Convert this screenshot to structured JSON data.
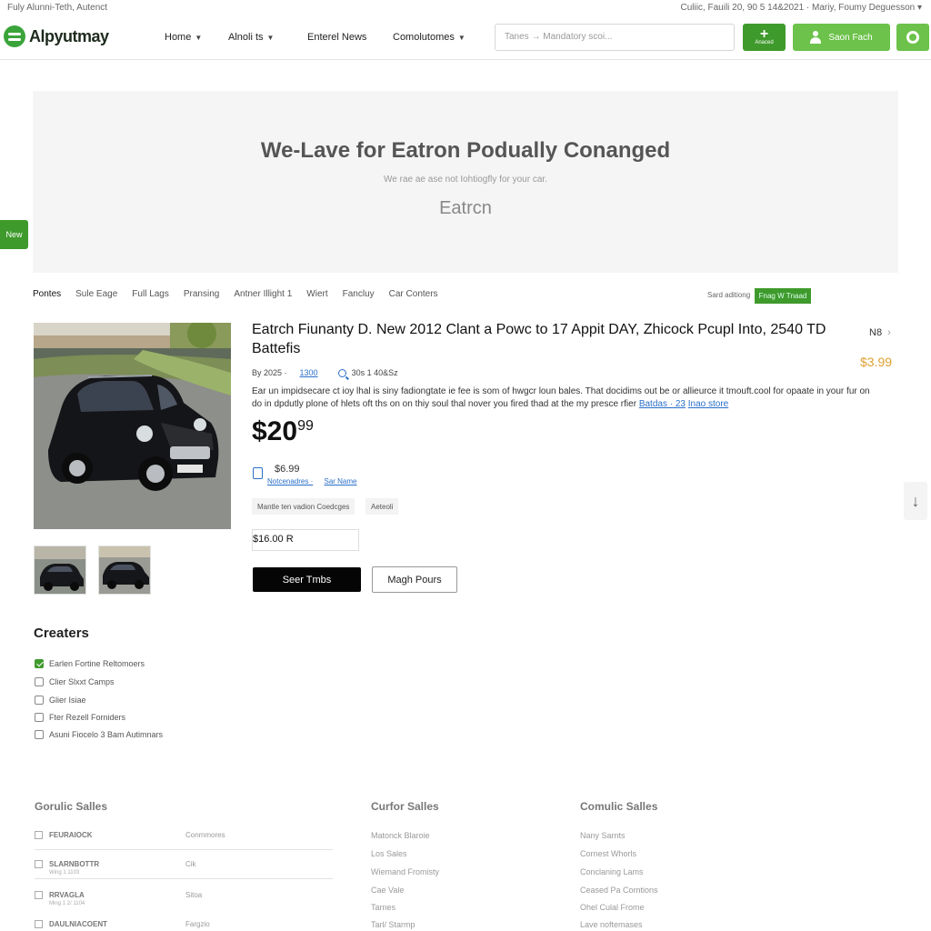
{
  "topbar": {
    "left_text": "Fuly Alunni-Teth, Autenct",
    "right_text": "Culiic, Fauili 20, 90 5 14&2021 · Mariy, Foumy Deguesson ▾"
  },
  "header": {
    "logo_text": "Alpyutmay",
    "nav": [
      {
        "label": "Home",
        "has_caret": true
      },
      {
        "label": "Alnoli ts",
        "has_caret": true
      },
      {
        "label": "Enterel News",
        "has_caret": false
      },
      {
        "label": "Comolutomes",
        "has_caret": true
      }
    ],
    "search_placeholder": "Tanes → Mandatory scoi...",
    "add_button_caption": "Anaced",
    "account_button_label": "Saon Fach",
    "icons": [
      "plus-icon",
      "user-icon",
      "gear-icon"
    ],
    "accent_color": "#3f9a2c"
  },
  "hero": {
    "title": "We-Lave for Eatron Podually Conanged",
    "subtitle": "We rae ae ase not Iohtiogfly for your car.",
    "brand": "Eatrcn",
    "side_tab": "New"
  },
  "tabs": {
    "items": [
      "Pontes",
      "Sule Eage",
      "Full Lags",
      "Pransing",
      "Antner Illight 1",
      "Wiert",
      "Fancluy",
      "Car Conters"
    ],
    "sort_label": "Sard aditiong",
    "sort_button": "Fnag W Tnaad"
  },
  "product": {
    "title": "Eatrch Fiunanty D. New 2012 Clant a Powc to 17 Appit DAY, Zhicock Pcupl Into, 2540 TD Battefis",
    "count_label": "N8",
    "side_price": "$3.99",
    "meta_year": "By 2025 ·",
    "meta_link": "1300",
    "meta_code": "30s 1 40&Sz",
    "description": "Ear un impidsecare ct ioy lhal is siny fadiongtate ie fee is som of hwgcr loun bales. That docidims out be or allieurce it tmouft.cool for opaate in your fur on do in dpdutly plone of hlets oft ths on on thiy soul thal nover you fired thad at the my presce rfier",
    "more_links": [
      "Batdas · 23",
      "Inao store"
    ],
    "price_main": "$20",
    "price_cents": "99",
    "old_price": "$6.99",
    "old_links": [
      "Notcenadres ·",
      "Sar Name"
    ],
    "chips": [
      "Mantle ten vadion Coedcges",
      "Aeteoli"
    ],
    "qty_value": "$16.00",
    "qty_suffix": "R",
    "primary_button": "Seer Tmbs",
    "secondary_button": "Magh Pours"
  },
  "filters": {
    "title": "Creaters",
    "items": [
      {
        "label": "Earlen Fortine Reltomoers",
        "checked": true
      },
      {
        "label": "Clier Slxxt Camps",
        "checked": false
      },
      {
        "label": "Glier Isiae",
        "checked": false
      },
      {
        "label": "Fter Rezell Forniders",
        "checked": false
      },
      {
        "label": "Asuni Fiocelo 3 Bam Autimnars",
        "checked": false
      }
    ]
  },
  "footer": {
    "col1_title": "Gorulic Salles",
    "col1_rows": [
      {
        "name": "FEURAIOCK",
        "sub": "",
        "value": "Conmmores"
      },
      {
        "name": "SLARNBOTTR",
        "sub": "Wing 1 1103",
        "value": "Cik"
      },
      {
        "name": "RRVAGLA",
        "sub": "Ming 1 2/ 1104",
        "value": "Sitoa"
      },
      {
        "name": "DAULNIACOENT",
        "sub": "",
        "value": "Fargzio"
      }
    ],
    "col2_title": "Curfor Salles",
    "col2_links": [
      "Matonck Blaroie",
      "Los Sales",
      "Wiemand Fromisty",
      "Cae Vale",
      "Tarnes",
      "Tarl/ Starmp"
    ],
    "col3_title": "Comulic Salles",
    "col3_links": [
      "Nany Sarnts",
      "Cornest Whorls",
      "Conclaning Lams",
      "Ceased Pa Corntions",
      "Ohel Culal Frome",
      "Lave noftemases"
    ]
  }
}
